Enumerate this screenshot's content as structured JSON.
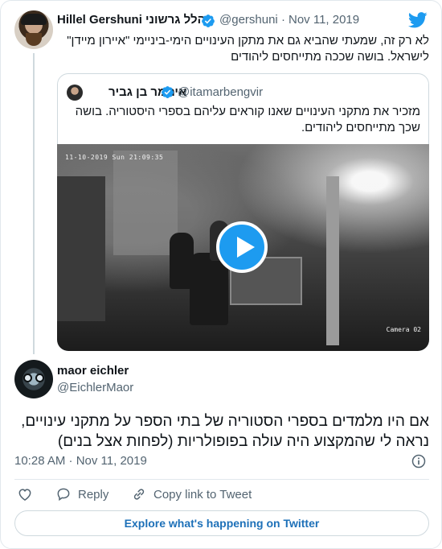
{
  "colors": {
    "accent": "#1d9bf0",
    "text": "#0f1419",
    "muted": "#536471",
    "border": "#cfd9de"
  },
  "tweet": {
    "author_name": "Hillel Gershuni הלל גרשוני",
    "handle": "@gershuni",
    "separator": "·",
    "date": "Nov 11, 2019",
    "verified_icon": "verified-badge-icon",
    "text": "לא רק זה, שמעתי שהביא גם את מתקן העינויים הימי-ביניימי \"איירון מיידן\" לישראל. בושה שככה מתייחסים ליהודים"
  },
  "quoted": {
    "author_name": "איתמר בן גביר",
    "handle": "@itamarbengvir",
    "text": "מזכיר את מתקני העינויים שאנו קוראים עליהם בספרי היסטוריה. בושה שכך מתייחסים ליהודים.",
    "video": {
      "timestamp": "11-10-2019 Sun 21:09:35",
      "camera": "Camera 02",
      "play_icon": "play-icon"
    }
  },
  "reply": {
    "author_name": "maor eichler",
    "handle": "@EichlerMaor",
    "text": "אם היו מלמדים בספרי הסטוריה של בתי הספר על מתקני עינויים, נראה לי שהמקצוע היה עולה בפופולריות (לפחות אצל בנים)",
    "timestamp": "10:28 AM · Nov 11, 2019"
  },
  "actions": {
    "like_icon": "heart-icon",
    "reply_label": "Reply",
    "copy_label": "Copy link to Tweet"
  },
  "footer": {
    "explore_label": "Explore what's happening on Twitter"
  }
}
